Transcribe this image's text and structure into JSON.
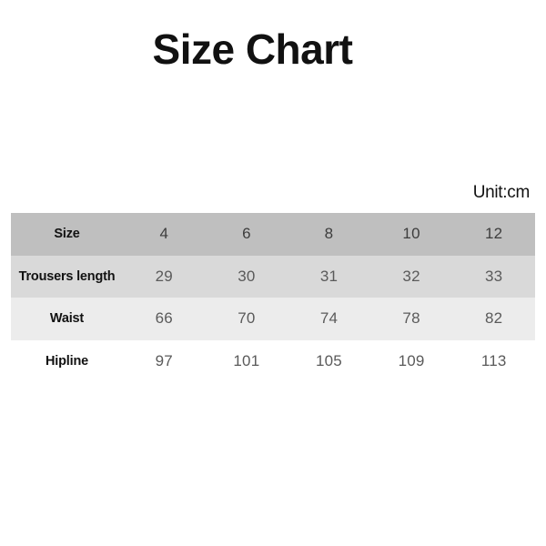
{
  "page": {
    "title": "Size Chart",
    "unit_note": "Unit:cm"
  },
  "colors": {
    "background": "#ffffff",
    "title_text": "#111111",
    "header_row_bg": "#bfbfbf",
    "row2_bg": "#d9d9d9",
    "row3_bg": "#ececec",
    "row4_bg": "#ffffff",
    "label_text": "#121212",
    "value_text": "#5a5a5a"
  },
  "chart_data": {
    "type": "table",
    "title": "Size Chart",
    "unit": "Unit:cm",
    "columns": [
      "Size",
      "4",
      "6",
      "8",
      "10",
      "12"
    ],
    "rows": [
      {
        "label": "Size",
        "values": [
          "4",
          "6",
          "8",
          "10",
          "12"
        ]
      },
      {
        "label": "Trousers length",
        "values": [
          "29",
          "30",
          "31",
          "32",
          "33"
        ]
      },
      {
        "label": "Waist",
        "values": [
          "66",
          "70",
          "74",
          "78",
          "82"
        ]
      },
      {
        "label": "Hipline",
        "values": [
          "97",
          "101",
          "105",
          "109",
          "113"
        ]
      }
    ]
  }
}
